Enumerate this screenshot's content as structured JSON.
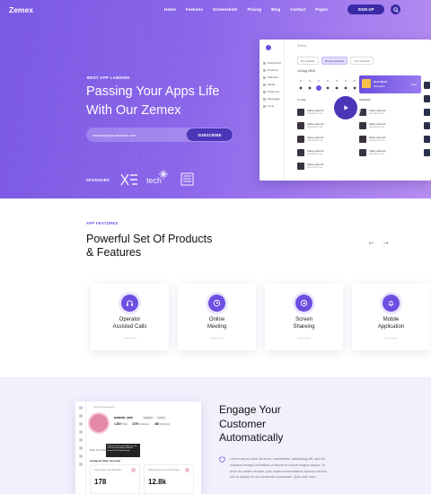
{
  "header": {
    "logo": "Zemex",
    "nav": [
      "Home",
      "Features",
      "Screenshots",
      "Pricing",
      "Blog",
      "Contact",
      "Pages"
    ],
    "signup_label": "SIGN UP",
    "search_icon": "search-icon"
  },
  "hero": {
    "kicker": "BEST APP LANDING",
    "title_line1": "Passing Your Apps Life",
    "title_line2": "With Our Zemex",
    "email_value": "example@yourdomain.com",
    "subscribe_label": "SUBSCRIBE",
    "sponsors_label": "SPONSORS",
    "sponsor_tech": "tech"
  },
  "mockup": {
    "search_placeholder": "Search...",
    "nav_items": [
      "Dashboard",
      "Products",
      "Statistics",
      "Media",
      "Programs",
      "Messages",
      "Tools"
    ],
    "pills": [
      "My schedule",
      "Product schedule",
      "Your schedule"
    ],
    "date": "14 Aug 2018",
    "card_title": "Next Week",
    "card_sub": "Schedule",
    "card_link": "View",
    "col_left": "CLASS",
    "col_right": "SESSION",
    "row_name": "Class name 01",
    "row_sub": "Description here"
  },
  "features": {
    "kicker": "APP FEATURES",
    "title_line1": "Powerful Set Of Products",
    "title_line2": "& Features",
    "prev": "←",
    "next": "→",
    "cards": [
      {
        "line1": "Operator",
        "line2": "Assisted Calls",
        "icon": "headset-icon"
      },
      {
        "line1": "Online",
        "line2": "Meeting",
        "icon": "clock-icon"
      },
      {
        "line1": "Screen",
        "line2": "Shareing",
        "icon": "screen-share-icon"
      },
      {
        "line1": "Mobile",
        "line2": "Application",
        "icon": "bell-icon"
      }
    ]
  },
  "bottom": {
    "app": {
      "search_placeholder": "Search Instagram",
      "username": "amanda_cash",
      "tag1": "Lifestyle",
      "tag2": "Social",
      "stat1_value": "1,352",
      "stat1_label": "Posts",
      "stat2_value": "147K",
      "stat2_label": "Followers",
      "stat3_value": "482",
      "stat3_label": "Following",
      "tooltip": "Web UI Kit presents Mockup to be used for the landing Software based on the Web design.",
      "tabs": "Main Info   Analytics",
      "overview": "Instagram Stats Overview",
      "box1_title": "Posts (Last Year 300 Max)",
      "box1_value": "178",
      "box2_title": "Followers (Last Year 300 Max)",
      "box2_value": "12.8k"
    },
    "title_line1": "Engage Your",
    "title_line2": "Customer",
    "title_line3": "Automatically",
    "paragraph": "Lorem ipsum dolor sit amet, consectetur adipisicing elit, sed do eiusmod tempor incididunt ut labore et dolore magna aliqua. Ut enim ad minim veniam, quis nostrud exercitation ullamco laboris nisi ut aliquip ex ea commodo consequat. Quis aute irure."
  },
  "colors": {
    "accent": "#6c4fe0",
    "accent_dark": "#3b2aa6",
    "hero_gradient_start": "#7b58e3",
    "hero_gradient_end": "#b78ef2",
    "bottom_bg": "#f1f0fd"
  }
}
